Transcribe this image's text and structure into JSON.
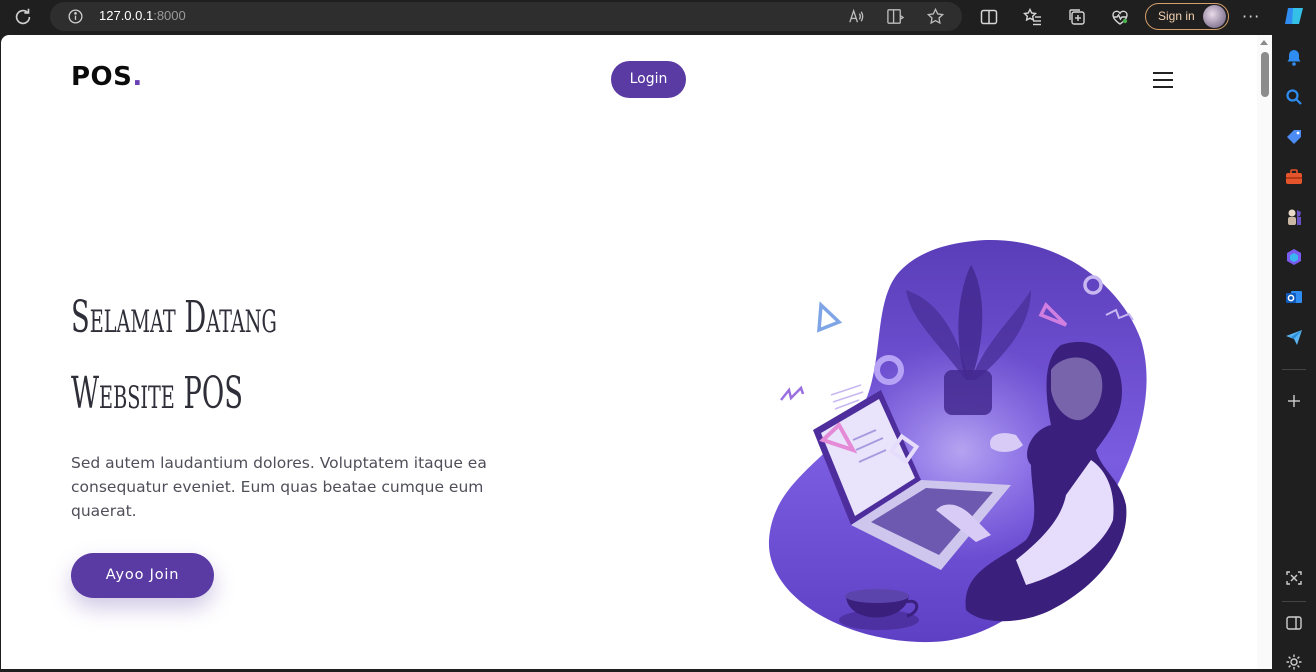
{
  "browser": {
    "url_host": "127.0.0.1",
    "url_port": ":8000",
    "signin_label": "Sign in",
    "more_label": "···"
  },
  "page": {
    "logo_text": "POS",
    "logo_dot": ".",
    "login_label": "Login",
    "hero_title_line1": "Selamat Datang",
    "hero_title_line2": "Website POS",
    "hero_text": "Sed autem laudantium dolores. Voluptatem itaque ea consequatur eveniet. Eum quas beatae cumque eum quaerat.",
    "join_label": "Ayoo Join"
  },
  "colors": {
    "accent": "#5a3aa3",
    "illustration_blob": "#6a4cc8"
  },
  "icons": {
    "toolbar": [
      "reload-icon",
      "info-icon",
      "read-aloud-icon",
      "immersive-reader-icon",
      "favorite-star-icon",
      "split-screen-icon",
      "favorites-icon",
      "collections-icon",
      "browser-essentials-icon",
      "more-icon"
    ],
    "sidebar": [
      "copilot-icon",
      "bell-icon",
      "search-icon",
      "shopping-tag-icon",
      "tools-icon",
      "games-icon",
      "microsoft365-icon",
      "outlook-icon",
      "telegram-icon",
      "add-icon",
      "screenshot-icon",
      "sidebar-toggle-icon",
      "settings-icon"
    ]
  }
}
